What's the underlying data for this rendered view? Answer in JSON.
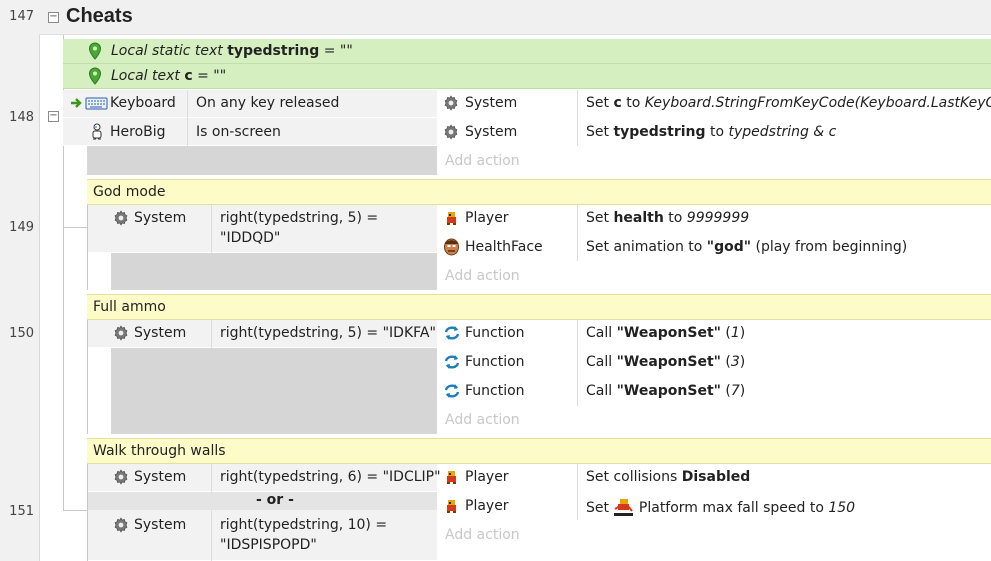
{
  "line_numbers": [
    "147",
    "148",
    "149",
    "150",
    "151"
  ],
  "group": {
    "title": "Cheats",
    "collapse_symbol": "−"
  },
  "local_vars": [
    {
      "kind": "Local static text",
      "name": "typedstring",
      "eq": " = ",
      "value": "\"\""
    },
    {
      "kind": "Local text",
      "name": "c",
      "eq": " = ",
      "value": "\"\""
    }
  ],
  "event148": {
    "collapse_symbol": "−",
    "conditions": [
      {
        "object": "Keyboard",
        "text": "On any key released"
      },
      {
        "object": "HeroBig",
        "text": "Is on-screen"
      }
    ],
    "actions": [
      {
        "object": "System",
        "pre": "Set ",
        "bold": "c",
        "mid": " to ",
        "italic": "Keyboard.StringFromKeyCode(Keyboard.LastKeyCode)",
        "post": ""
      },
      {
        "object": "System",
        "pre": "Set ",
        "bold": "typedstring",
        "mid": " to ",
        "italic": "typedstring & c",
        "post": ""
      }
    ],
    "add_action": "Add action"
  },
  "event149": {
    "comment": "God mode",
    "condition": {
      "object": "System",
      "line1": "right(typedstring, 5) =",
      "line2": "\"IDDQD\""
    },
    "actions": [
      {
        "object": "Player",
        "pre": "Set ",
        "bold": "health",
        "mid": " to ",
        "italic": "9999999",
        "post": ""
      },
      {
        "object": "HealthFace",
        "pre": "Set animation to ",
        "bold": "\"god\"",
        "mid": "",
        "italic": "",
        "post": " (play from beginning)"
      }
    ],
    "add_action": "Add action"
  },
  "event150": {
    "comment": "Full ammo",
    "condition": {
      "object": "System",
      "line1": "right(typedstring, 5) = \"IDKFA\""
    },
    "actions": [
      {
        "object": "Function",
        "pre": "Call ",
        "bold": "\"WeaponSet\"",
        "mid": " (",
        "italic": "1",
        "post": ")"
      },
      {
        "object": "Function",
        "pre": "Call ",
        "bold": "\"WeaponSet\"",
        "mid": " (",
        "italic": "3",
        "post": ")"
      },
      {
        "object": "Function",
        "pre": "Call ",
        "bold": "\"WeaponSet\"",
        "mid": " (",
        "italic": "7",
        "post": ")"
      }
    ],
    "add_action": "Add action"
  },
  "event151": {
    "comment": "Walk through walls",
    "conditions": [
      {
        "object": "System",
        "line1": "right(typedstring, 6) = \"IDCLIP\""
      },
      {
        "object": "System",
        "line1": "right(typedstring, 10) =",
        "line2": "\"IDSPISPOPD\""
      }
    ],
    "or_label": "- or -",
    "actions": [
      {
        "object": "Player",
        "pre": "Set collisions ",
        "bold": "Disabled"
      },
      {
        "object": "Player",
        "pre": "Set ",
        "mid": " Platform max fall speed to ",
        "italic": "150"
      }
    ],
    "add_action": "Add action"
  },
  "icons": {
    "keyboard": "keyboard-icon",
    "herobig": "hero-sprite-icon",
    "system": "gear-icon",
    "player": "player-sprite-icon",
    "healthface": "face-sprite-icon",
    "function": "function-arrows-icon",
    "variable": "map-pin-icon"
  },
  "colors": {
    "local_var_bg": "#d6efc0",
    "comment_bg": "#fdfcc8",
    "condition_bg": "#f2f2f2",
    "condition_empty": "#d6d6d6",
    "gutter": "#f1f1f1"
  }
}
